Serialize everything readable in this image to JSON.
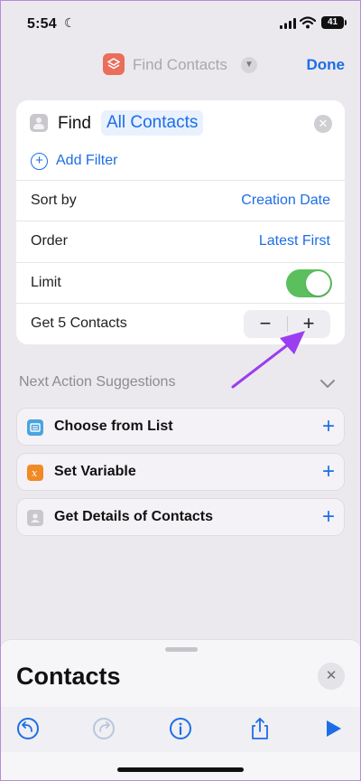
{
  "status_bar": {
    "time": "5:54",
    "battery": "41"
  },
  "nav": {
    "title": "Find Contacts",
    "done_label": "Done"
  },
  "action": {
    "verb": "Find",
    "target": "All Contacts",
    "add_filter_label": "Add Filter",
    "rows": [
      {
        "label": "Sort by",
        "value": "Creation Date"
      },
      {
        "label": "Order",
        "value": "Latest First"
      },
      {
        "label": "Limit",
        "toggle_on": true
      },
      {
        "label": "Get 5 Contacts",
        "stepper_minus": "−",
        "stepper_plus": "+"
      }
    ]
  },
  "suggestions": {
    "header": "Next Action Suggestions",
    "items": [
      {
        "label": "Choose from List",
        "icon": "list-icon",
        "color": "#4aa3df"
      },
      {
        "label": "Set Variable",
        "icon": "variable-icon",
        "color": "#f08a24"
      },
      {
        "label": "Get Details of Contacts",
        "icon": "contacts-icon",
        "color": "#c9c7cc"
      }
    ],
    "add_symbol": "+"
  },
  "sheet": {
    "title": "Contacts",
    "close_symbol": "✕"
  },
  "toolbar": {
    "items": [
      "undo-icon",
      "redo-icon",
      "info-icon",
      "share-icon",
      "play-icon"
    ]
  },
  "colors": {
    "accent": "#1d6ee6",
    "toggle_on": "#5cbf5d",
    "annotation_arrow": "#9b3df0"
  }
}
